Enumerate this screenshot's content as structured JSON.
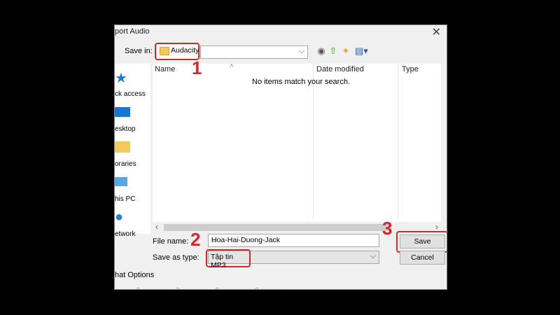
{
  "dialog": {
    "title": "port Audio",
    "close_glyph": "✕"
  },
  "save_in": {
    "label": "Save in:",
    "folder": "Audacity"
  },
  "places": [
    {
      "label": "ck access",
      "icon": "star-icon"
    },
    {
      "label": "esktop",
      "icon": "desktop-icon"
    },
    {
      "label": "oraries",
      "icon": "libraries-icon"
    },
    {
      "label": "his PC",
      "icon": "computer-icon"
    },
    {
      "label": "etwork",
      "icon": "network-icon"
    }
  ],
  "file_list": {
    "headers": {
      "name": "Name",
      "date": "Date modified",
      "type": "Type"
    },
    "empty_message": "No items match your search."
  },
  "fields": {
    "file_name_label": "File name:",
    "file_name_value": "Hoa-Hai-Duong-Jack",
    "save_type_label": "Save as type:",
    "save_type_value": "Tập tin MP3"
  },
  "buttons": {
    "save": "Save",
    "cancel": "Cancel"
  },
  "format_options_label": "hat Options",
  "annotations": [
    "1",
    "2",
    "3"
  ],
  "colors": {
    "annotation": "#d9262b"
  }
}
